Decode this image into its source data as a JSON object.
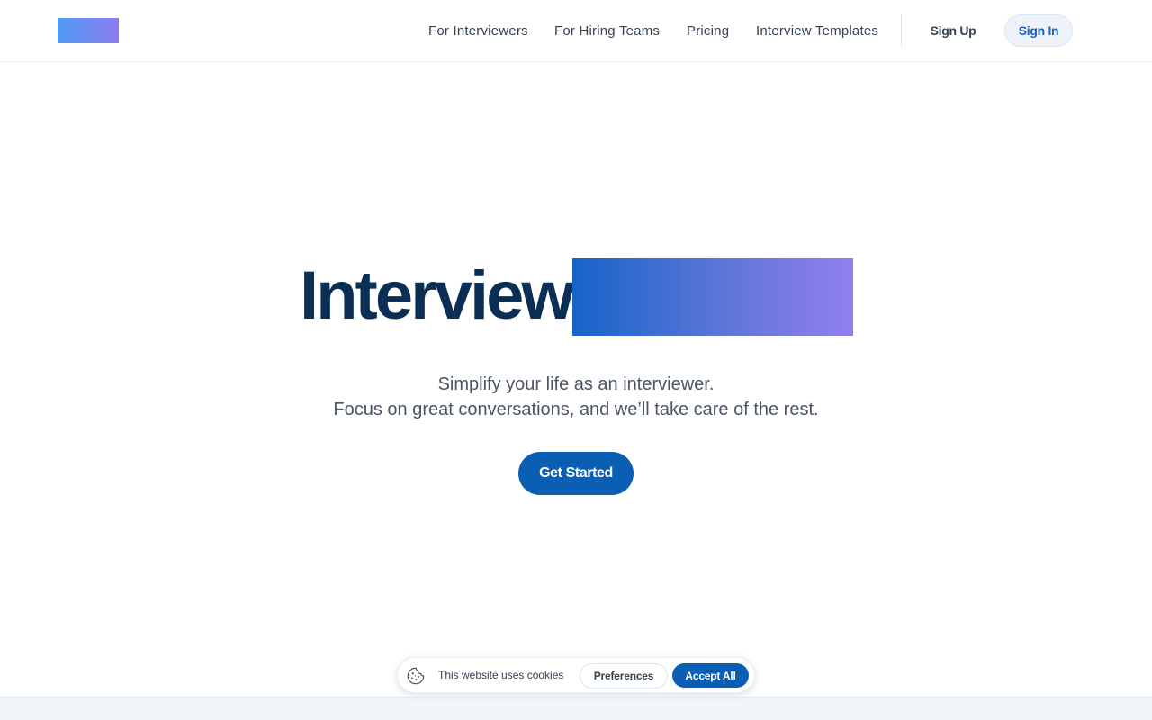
{
  "header": {
    "nav": [
      {
        "label": "For Interviewers"
      },
      {
        "label": "For Hiring Teams"
      },
      {
        "label": "Pricing"
      },
      {
        "label": "Interview Templates"
      }
    ],
    "sign_up_label": "Sign Up",
    "sign_in_label": "Sign In"
  },
  "hero": {
    "title": "Interview",
    "subtitle_line1": "Simplify your life as an interviewer.",
    "subtitle_line2": "Focus on great conversations, and we’ll take care of the rest.",
    "cta_label": "Get Started"
  },
  "cookie_banner": {
    "icon": "cookie-icon",
    "message": "This website uses cookies",
    "preferences_label": "Preferences",
    "accept_label": "Accept All"
  },
  "colors": {
    "primary": "#0a5fb4",
    "title": "#0b2e55",
    "logo_gradient_start": "#4f9cf5",
    "logo_gradient_end": "#8b7cf0"
  }
}
